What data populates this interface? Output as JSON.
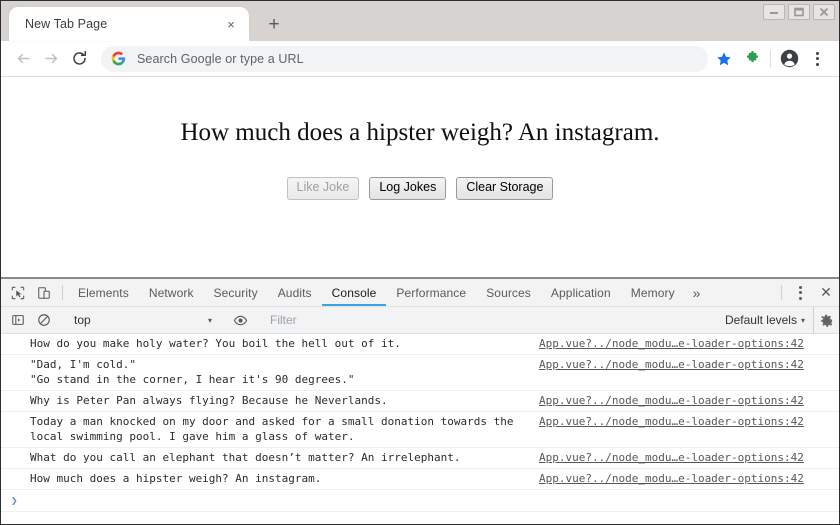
{
  "window": {
    "controls": [
      "minimize-button",
      "maximize-button",
      "close-button"
    ]
  },
  "tabstrip": {
    "tab_title": "New Tab Page",
    "close_label": "×",
    "newtab_label": "+"
  },
  "toolbar": {
    "back_label": "back-arrow",
    "forward_label": "forward-arrow",
    "reload_label": "reload",
    "omnibox_placeholder": "Search Google or type a URL",
    "bookmark_color": "#1a73e8",
    "extension_color": "#2e9e4f"
  },
  "page": {
    "joke_heading": "How much does a hipster weigh? An instagram.",
    "buttons": [
      {
        "label": "Like Joke",
        "disabled": true
      },
      {
        "label": "Log Jokes",
        "disabled": false
      },
      {
        "label": "Clear Storage",
        "disabled": false
      }
    ]
  },
  "devtools": {
    "tabs": [
      {
        "label": "Elements",
        "active": false
      },
      {
        "label": "Network",
        "active": false
      },
      {
        "label": "Security",
        "active": false
      },
      {
        "label": "Audits",
        "active": false
      },
      {
        "label": "Console",
        "active": true
      },
      {
        "label": "Performance",
        "active": false
      },
      {
        "label": "Sources",
        "active": false
      },
      {
        "label": "Application",
        "active": false
      },
      {
        "label": "Memory",
        "active": false
      }
    ],
    "more_tabs_label": "»",
    "close_label": "✕",
    "active_tab_underline": "#38a5e4",
    "filterbar": {
      "context": "top",
      "context_caret": "▾",
      "filter_placeholder": "Filter",
      "levels_label": "Default levels",
      "levels_caret": "▾"
    },
    "console": {
      "messages": [
        {
          "text": "How do you make holy water? You boil the hell out of it.",
          "source": "App.vue?../node_modu…e-loader-options:42"
        },
        {
          "text": "\"Dad, I'm cold.\"\n\"Go stand in the corner, I hear it's 90 degrees.\"",
          "source": "App.vue?../node_modu…e-loader-options:42"
        },
        {
          "text": "Why is Peter Pan always flying? Because he Neverlands.",
          "source": "App.vue?../node_modu…e-loader-options:42"
        },
        {
          "text": "Today a man knocked on my door and asked for a small donation towards the\nlocal swimming pool. I gave him a glass of water.",
          "source": "App.vue?../node_modu…e-loader-options:42"
        },
        {
          "text": "What do you call an elephant that doesn’t matter? An irrelephant.",
          "source": "App.vue?../node_modu…e-loader-options:42"
        },
        {
          "text": "How much does a hipster weigh? An instagram.",
          "source": "App.vue?../node_modu…e-loader-options:42"
        }
      ],
      "prompt_arrow": "❯",
      "prompt_value": ""
    }
  }
}
